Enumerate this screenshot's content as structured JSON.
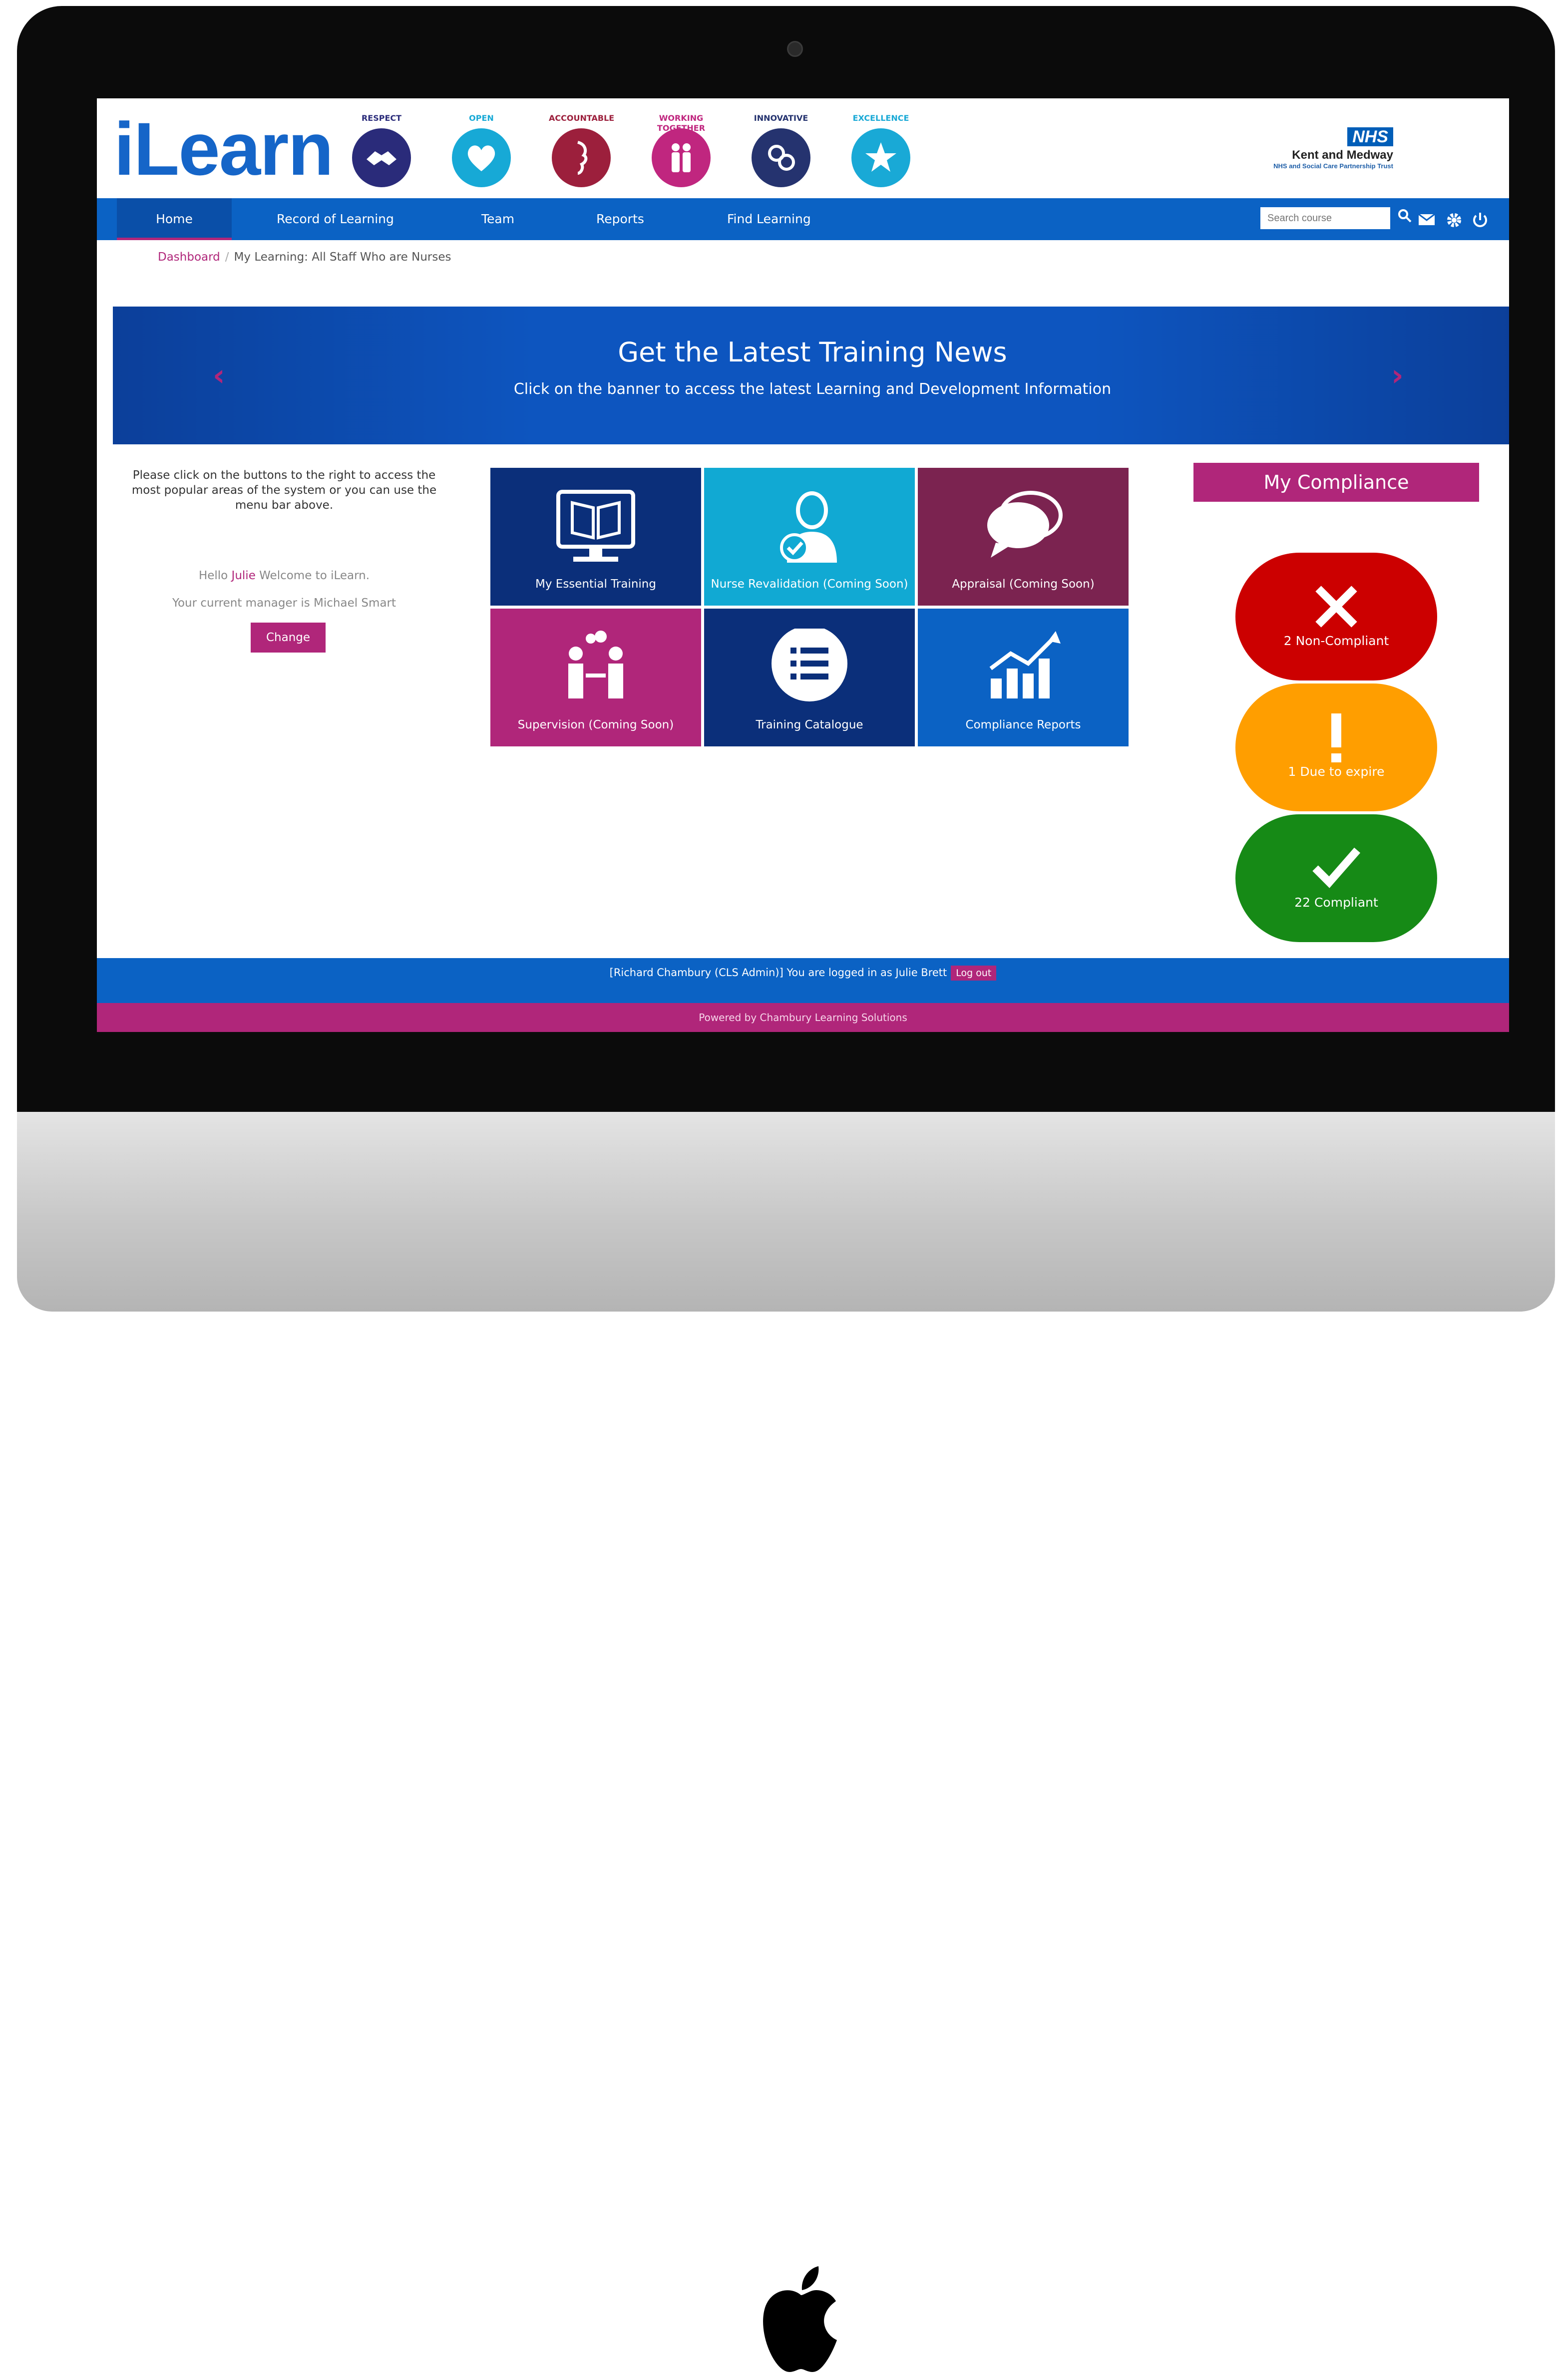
{
  "header": {
    "logo": "iLearn",
    "values": [
      {
        "caption": "RESPECT",
        "color": "#2a2b7a"
      },
      {
        "caption": "OPEN",
        "color": "#17a9d6"
      },
      {
        "caption": "ACCOUNTABLE",
        "color": "#9c1f3c"
      },
      {
        "caption": "WORKING TOGETHER",
        "color": "#c0267f"
      },
      {
        "caption": "INNOVATIVE",
        "color": "#25336f"
      },
      {
        "caption": "EXCELLENCE",
        "color": "#19a9d6"
      }
    ],
    "nhs": {
      "tag": "NHS",
      "trust": "Kent and Medway",
      "subtitle": "NHS and Social Care Partnership Trust"
    }
  },
  "nav": {
    "items": [
      "Home",
      "Record of Learning",
      "Team",
      "Reports",
      "Find Learning"
    ],
    "search_placeholder": "Search course",
    "icons": [
      "search-icon",
      "mail-icon",
      "gear-icon",
      "power-icon"
    ]
  },
  "breadcrumb": {
    "root": "Dashboard",
    "separator": "/",
    "current": "My Learning: All Staff Who are Nurses"
  },
  "banner": {
    "title": "Get the Latest Training News",
    "subtitle": "Click on the banner to access the latest Learning and Development Information"
  },
  "intro": {
    "text": "Please click on the buttons to the right to access the most popular areas of the system or you can use the menu bar above.",
    "greeting_prefix": "Hello ",
    "greeting_name": "Julie",
    "greeting_suffix": " Welcome to iLearn.",
    "manager_line": "Your current manager is Michael Smart",
    "change_label": "Change"
  },
  "tiles": [
    {
      "label": "My Essential Training",
      "icon": "monitor-book-icon",
      "color": "#0b2f7a"
    },
    {
      "label": "Nurse Revalidation (Coming Soon)",
      "icon": "nurse-icon",
      "color": "#11a9d3"
    },
    {
      "label": "Appraisal (Coming Soon)",
      "icon": "speech-bubbles-icon",
      "color": "#7b2350"
    },
    {
      "label": "Supervision (Coming Soon)",
      "icon": "meeting-icon",
      "color": "#b0267a"
    },
    {
      "label": "Training Catalogue",
      "icon": "list-icon",
      "color": "#0b2f7a"
    },
    {
      "label": "Compliance Reports",
      "icon": "growth-chart-icon",
      "color": "#0b62c4"
    }
  ],
  "compliance": {
    "title": "My Compliance",
    "items": [
      {
        "label": "2 Non-Compliant",
        "icon": "cross-icon",
        "color": "#cc0000"
      },
      {
        "label": "1 Due to expire",
        "icon": "exclamation-icon",
        "color": "#ff9e00"
      },
      {
        "label": "22 Compliant",
        "icon": "check-icon",
        "color": "#168a16"
      }
    ]
  },
  "footer": {
    "login_text": "[Richard Chambury (CLS Admin)] You are logged in as Julie Brett",
    "logout_label": "Log out",
    "powered_by": "Powered by Chambury Learning Solutions"
  }
}
